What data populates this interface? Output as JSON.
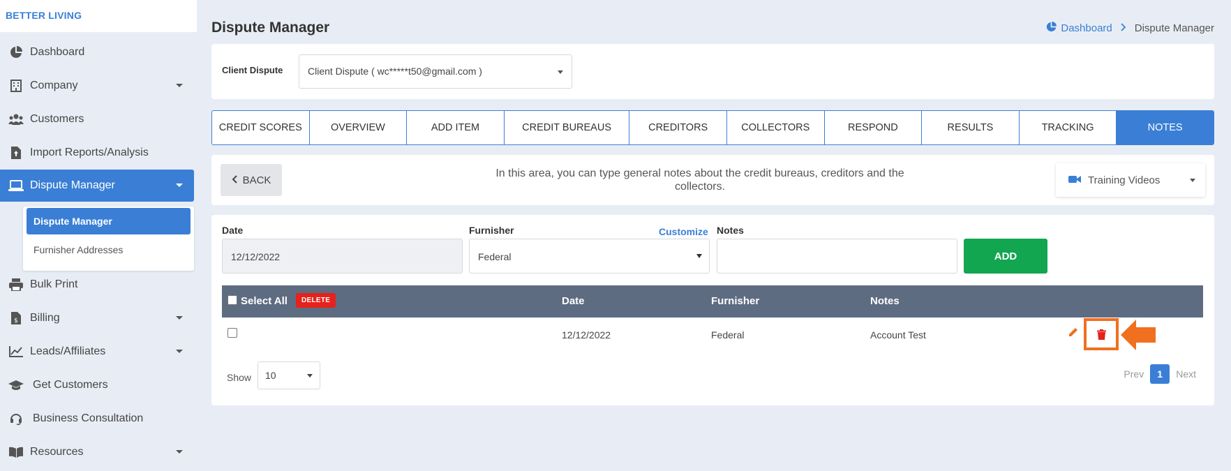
{
  "brand": "BETTER LIVING",
  "sidebar": {
    "items": [
      {
        "label": "Dashboard",
        "icon": "pie-chart-icon"
      },
      {
        "label": "Company",
        "icon": "building-icon",
        "has_caret": true
      },
      {
        "label": "Customers",
        "icon": "users-icon"
      },
      {
        "label": "Import Reports/Analysis",
        "icon": "file-upload-icon"
      },
      {
        "label": "Dispute Manager",
        "icon": "laptop-icon",
        "has_caret": true,
        "active": true
      },
      {
        "label": "Bulk Print",
        "icon": "printer-icon"
      },
      {
        "label": "Billing",
        "icon": "invoice-icon",
        "has_caret": true
      },
      {
        "label": "Leads/Affiliates",
        "icon": "line-chart-icon",
        "has_caret": true
      },
      {
        "label": "Get Customers",
        "icon": "graduation-cap-icon"
      },
      {
        "label": "Business Consultation",
        "icon": "headset-icon"
      },
      {
        "label": "Resources",
        "icon": "book-icon",
        "has_caret": true
      }
    ],
    "submenu": [
      {
        "label": "Dispute Manager",
        "active": true
      },
      {
        "label": "Furnisher Addresses"
      }
    ]
  },
  "header": {
    "title": "Dispute Manager",
    "breadcrumb": {
      "home": "Dashboard",
      "current": "Dispute Manager"
    }
  },
  "client": {
    "label": "Client Dispute",
    "selected": "Client Dispute ( wc*****t50@gmail.com )"
  },
  "tabs": [
    {
      "label": "CREDIT SCORES"
    },
    {
      "label": "OVERVIEW"
    },
    {
      "label": "ADD ITEM"
    },
    {
      "label": "CREDIT BUREAUS"
    },
    {
      "label": "CREDITORS"
    },
    {
      "label": "COLLECTORS"
    },
    {
      "label": "RESPOND"
    },
    {
      "label": "RESULTS"
    },
    {
      "label": "TRACKING"
    },
    {
      "label": "NOTES",
      "active": true
    }
  ],
  "info": {
    "back_label": "BACK",
    "text": "In this area, you can type general notes about the credit bureaus, creditors and the collectors.",
    "videos_label": "Training Videos"
  },
  "form": {
    "date_label": "Date",
    "date_value": "12/12/2022",
    "furnisher_label": "Furnisher",
    "furnisher_value": "Federal",
    "customize_label": "Customize",
    "notes_label": "Notes",
    "notes_value": "",
    "add_label": "ADD"
  },
  "table": {
    "select_all": "Select All",
    "delete_label": "DELETE",
    "headers": {
      "date": "Date",
      "furnisher": "Furnisher",
      "notes": "Notes"
    },
    "rows": [
      {
        "date": "12/12/2022",
        "furnisher": "Federal",
        "notes": "Account Test"
      }
    ]
  },
  "pagination": {
    "show_label": "Show",
    "per_page": "10",
    "prev": "Prev",
    "current": "1",
    "next": "Next"
  },
  "colors": {
    "accent": "#3a7fd5",
    "add_button": "#12a650",
    "delete_badge": "#e5221b",
    "highlight": "#f07020",
    "table_header": "#5e6c82"
  }
}
